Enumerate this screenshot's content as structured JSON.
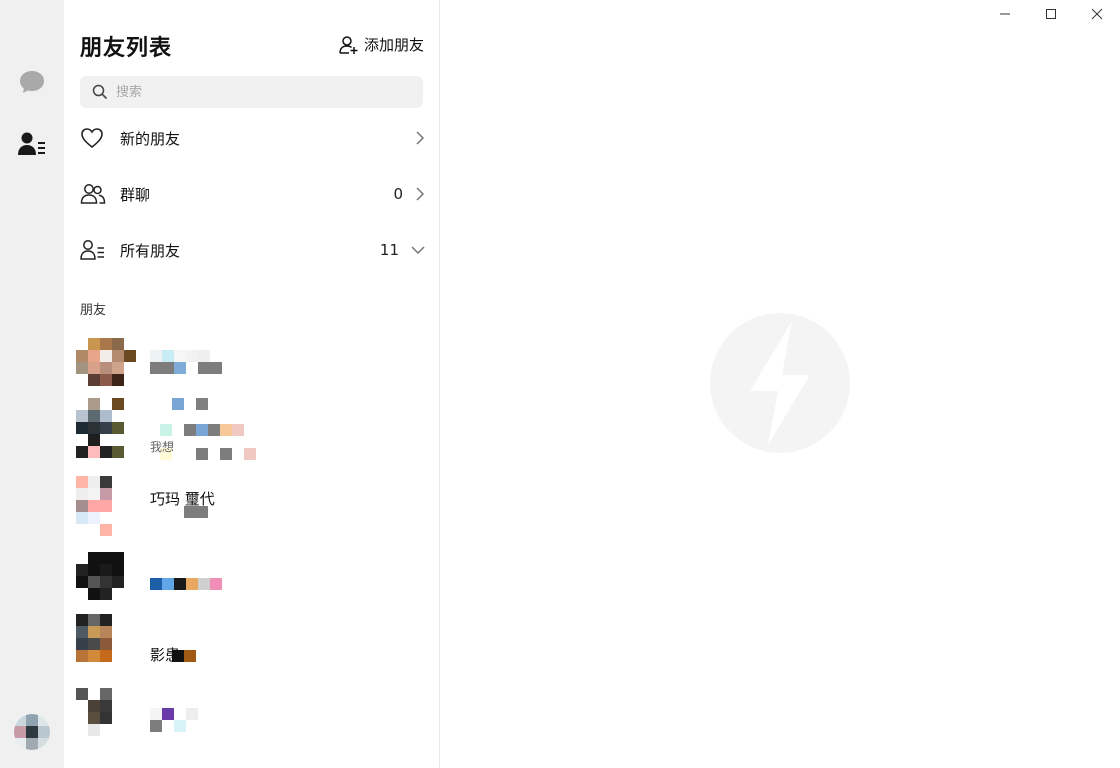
{
  "sidebar": {
    "chat_icon": "chat-bubble-icon",
    "contacts_icon": "contacts-icon"
  },
  "panel": {
    "title": "朋友列表",
    "add_friend_label": "添加朋友",
    "search_placeholder": "搜索",
    "menu": [
      {
        "label": "新的朋友",
        "count": "",
        "icon": "heart-icon",
        "arrow": "chevron-right-icon"
      },
      {
        "label": "群聊",
        "count": "0",
        "icon": "group-icon",
        "arrow": "chevron-right-icon"
      },
      {
        "label": "所有朋友",
        "count": "11",
        "icon": "contacts-list-icon",
        "arrow": "chevron-down-icon"
      }
    ],
    "section_label": "朋友",
    "friends": [
      {
        "name": "",
        "subtitle": ""
      },
      {
        "name": "",
        "subtitle": "我想"
      },
      {
        "name": "巧玛 璽代",
        "subtitle": ""
      },
      {
        "name": "",
        "subtitle": ""
      },
      {
        "name": "影患",
        "subtitle": ""
      },
      {
        "name": "",
        "subtitle": ""
      }
    ]
  },
  "window_controls": [
    "minimize-icon",
    "maximize-icon",
    "close-icon"
  ],
  "colors": {
    "rail_bg": "#f0f0f0",
    "search_bg": "#f1f1f1",
    "watermark": "#f4f4f4"
  }
}
